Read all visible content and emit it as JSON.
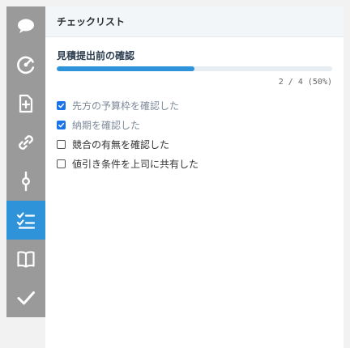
{
  "panel": {
    "header_title": "チェックリスト"
  },
  "rail": {
    "icons": [
      {
        "name": "speech-bubble-icon",
        "active": false
      },
      {
        "name": "gauge-icon",
        "active": false
      },
      {
        "name": "file-add-icon",
        "active": false
      },
      {
        "name": "link-icon",
        "active": false
      },
      {
        "name": "commit-icon",
        "active": false
      },
      {
        "name": "checklist-icon",
        "active": true
      },
      {
        "name": "book-icon",
        "active": false
      },
      {
        "name": "checkmark-icon",
        "active": false
      }
    ],
    "active_color": "#2f93d9",
    "rail_color": "#9a9a9a"
  },
  "checklist": {
    "title": "見積提出前の確認",
    "progress": {
      "completed": 2,
      "total": 4,
      "fraction": 0.5,
      "text": "2 / 4 (50%)"
    },
    "items": [
      {
        "label": "先方の予算枠を確認した",
        "checked": true
      },
      {
        "label": "納期を確認した",
        "checked": true
      },
      {
        "label": "競合の有無を確認した",
        "checked": false
      },
      {
        "label": "値引き条件を上司に共有した",
        "checked": false
      }
    ]
  }
}
